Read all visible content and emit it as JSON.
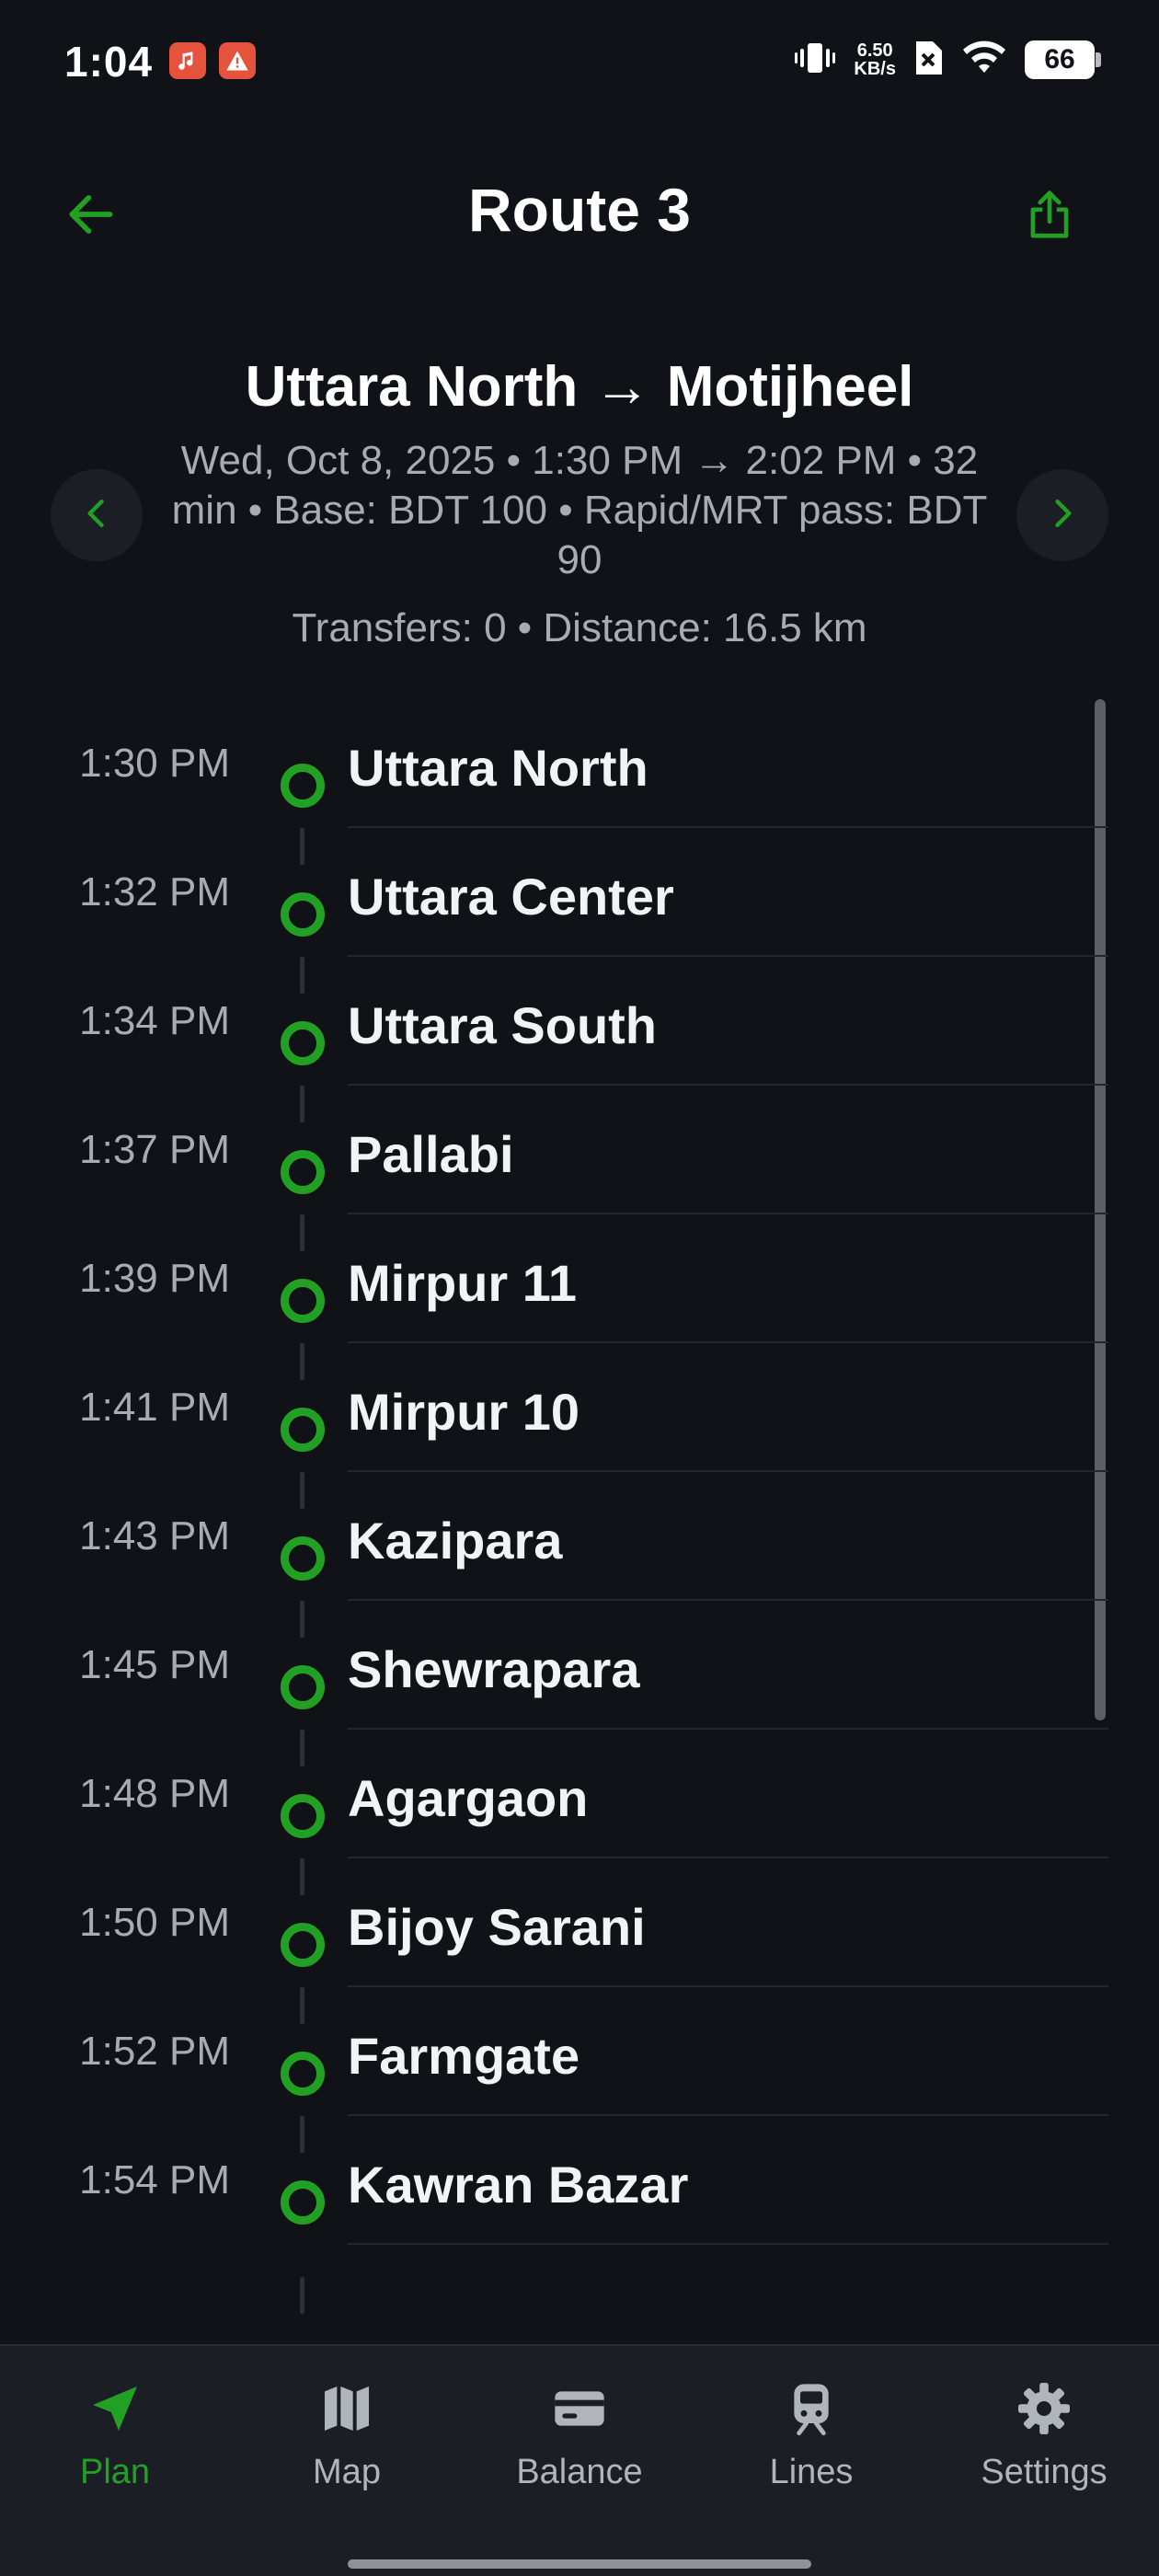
{
  "status_bar": {
    "time": "1:04",
    "net_speed_value": "6.50",
    "net_speed_unit": "KB/s",
    "battery": "66"
  },
  "header": {
    "title": "Route 3",
    "back_icon": "arrow-left-icon",
    "share_icon": "share-icon"
  },
  "summary": {
    "route_title": "Uttara North → Motijheel",
    "meta": "Wed, Oct 8, 2025 • 1:30 PM → 2:02 PM • 32 min • Base: BDT 100 • Rapid/MRT pass: BDT 90",
    "stats": "Transfers: 0 • Distance: 16.5 km"
  },
  "stops": [
    {
      "time": "1:30 PM",
      "name": "Uttara North"
    },
    {
      "time": "1:32 PM",
      "name": "Uttara Center"
    },
    {
      "time": "1:34 PM",
      "name": "Uttara South"
    },
    {
      "time": "1:37 PM",
      "name": "Pallabi"
    },
    {
      "time": "1:39 PM",
      "name": "Mirpur 11"
    },
    {
      "time": "1:41 PM",
      "name": "Mirpur 10"
    },
    {
      "time": "1:43 PM",
      "name": "Kazipara"
    },
    {
      "time": "1:45 PM",
      "name": "Shewrapara"
    },
    {
      "time": "1:48 PM",
      "name": "Agargaon"
    },
    {
      "time": "1:50 PM",
      "name": "Bijoy Sarani"
    },
    {
      "time": "1:52 PM",
      "name": "Farmgate"
    },
    {
      "time": "1:54 PM",
      "name": "Kawran Bazar"
    }
  ],
  "bottom_nav": [
    {
      "label": "Plan",
      "icon": "navigation-arrow-icon",
      "active": true
    },
    {
      "label": "Map",
      "icon": "map-icon",
      "active": false
    },
    {
      "label": "Balance",
      "icon": "card-icon",
      "active": false
    },
    {
      "label": "Lines",
      "icon": "train-icon",
      "active": false
    },
    {
      "label": "Settings",
      "icon": "gear-icon",
      "active": false
    }
  ],
  "colors": {
    "background": "#101217",
    "accent": "#22a024",
    "muted_text": "#a7abb3",
    "nav_background": "#1b1e24"
  }
}
